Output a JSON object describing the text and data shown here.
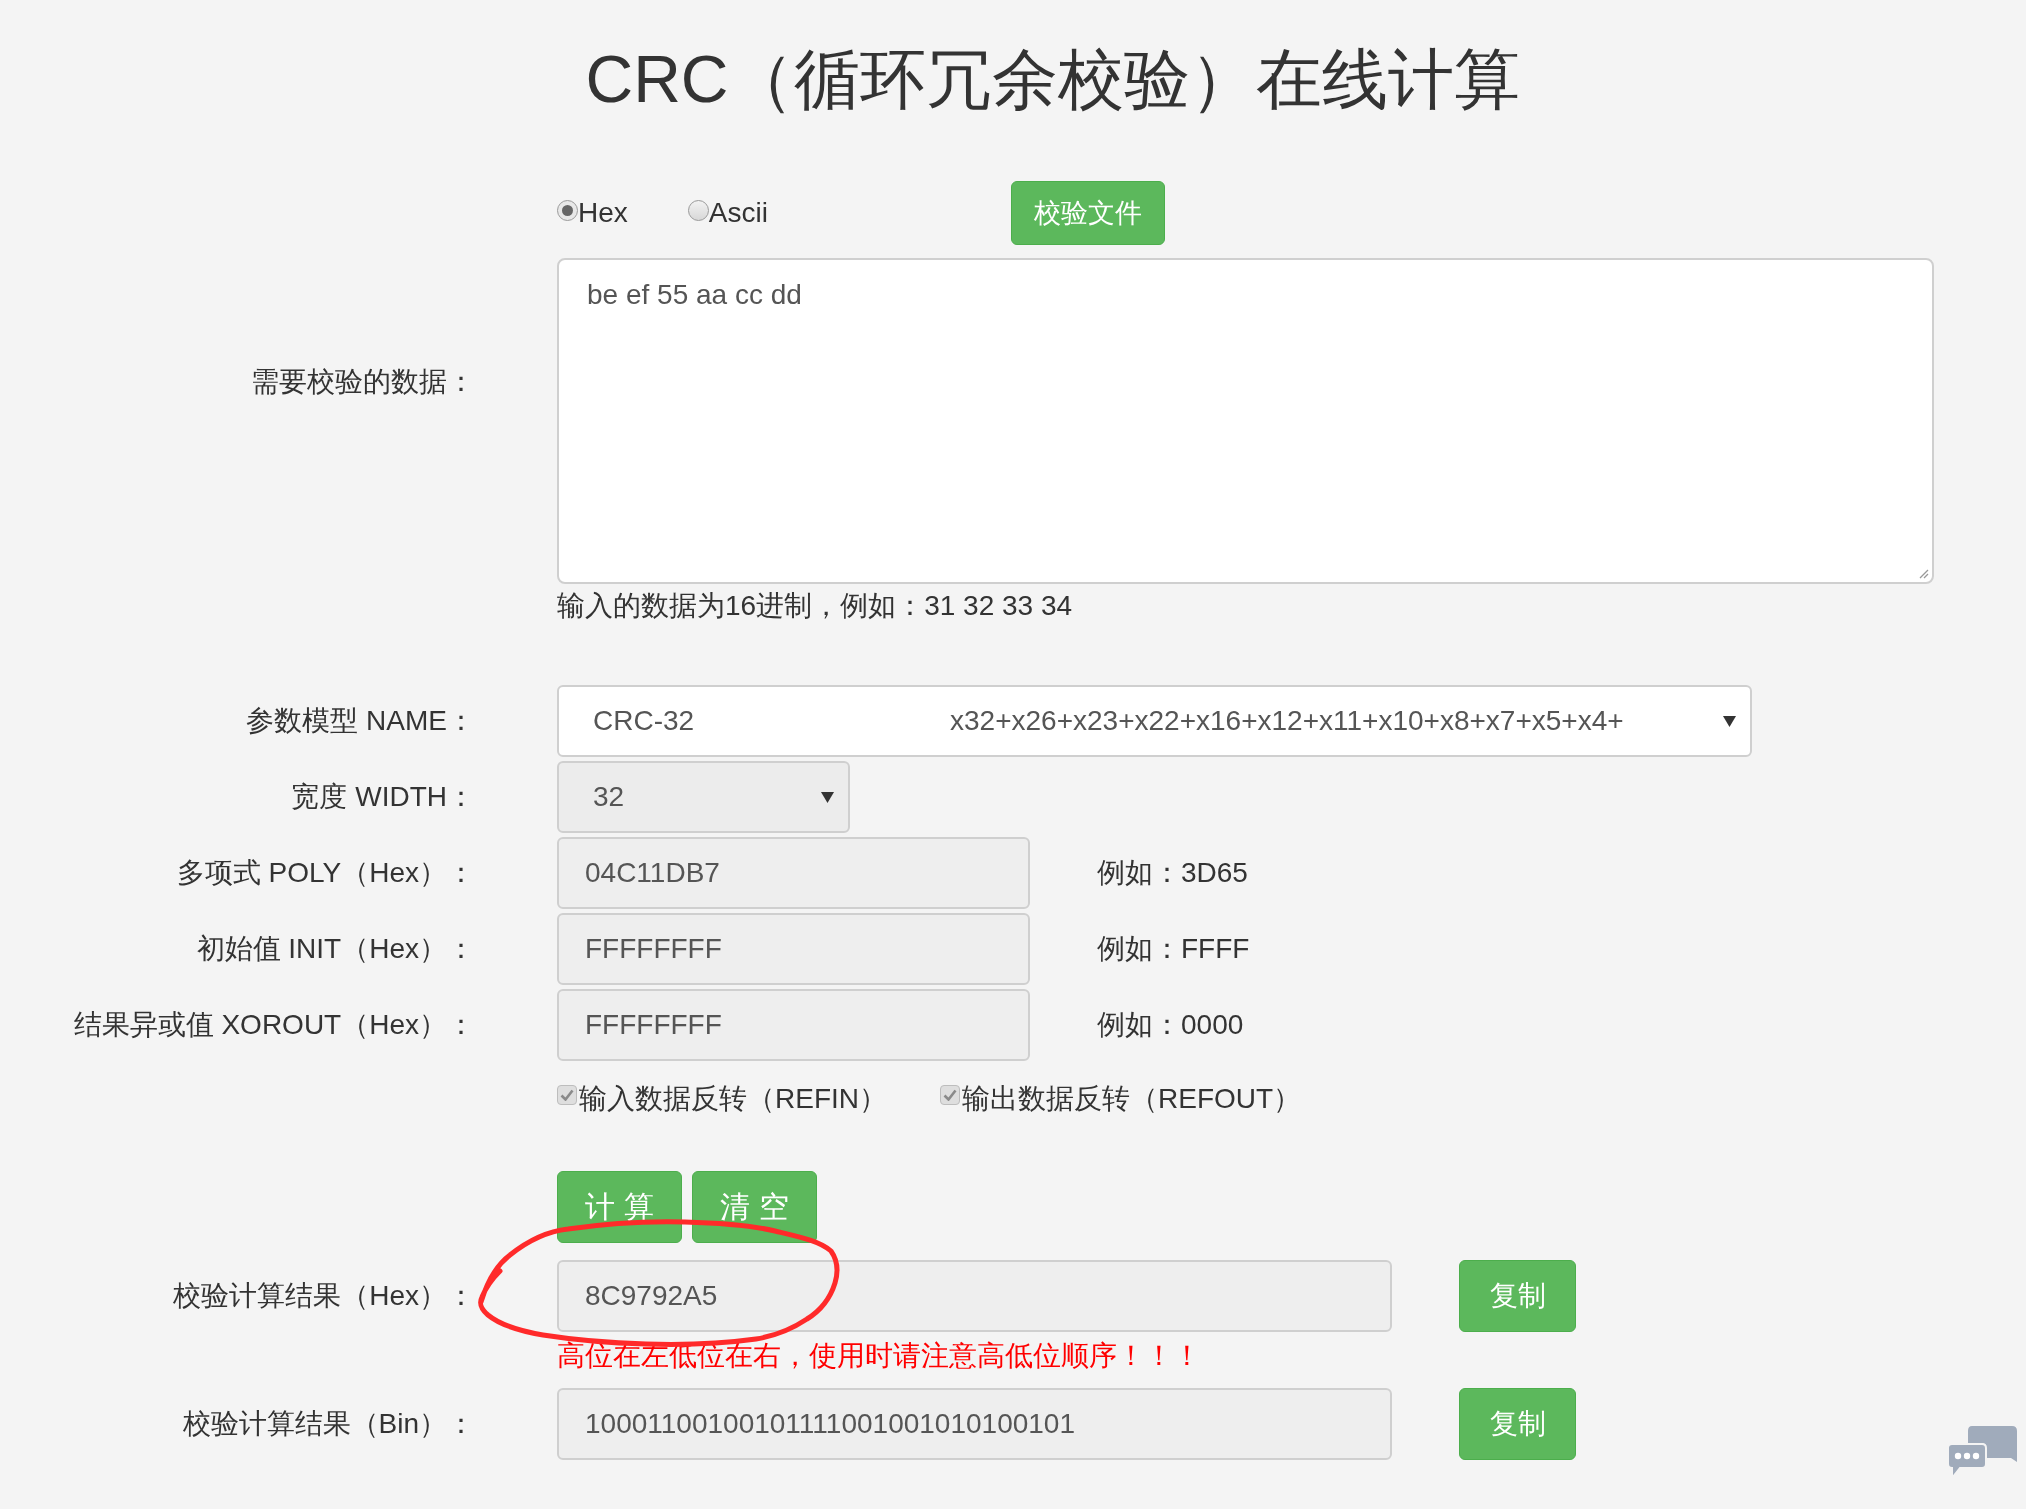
{
  "title": "CRC（循环冗余校验）在线计算",
  "input_mode": {
    "options": [
      {
        "label": "Hex",
        "selected": true
      },
      {
        "label": "Ascii",
        "selected": false
      }
    ],
    "file_button": "校验文件"
  },
  "data_field": {
    "label": "需要校验的数据：",
    "value": "be ef 55 aa cc dd",
    "hint": "输入的数据为16进制，例如：31 32 33 34"
  },
  "model": {
    "label": "参数模型 NAME：",
    "name": "CRC-32",
    "polynomial": "x32+x26+x23+x22+x16+x12+x11+x10+x8+x7+x5+x4+",
    "disabled": false
  },
  "width": {
    "label": "宽度 WIDTH：",
    "value": "32",
    "disabled": true
  },
  "params": [
    {
      "label": "多项式 POLY（Hex）：",
      "value": "04C11DB7",
      "example": "例如：3D65",
      "disabled": true
    },
    {
      "label": "初始值 INIT（Hex）：",
      "value": "FFFFFFFF",
      "example": "例如：FFFF",
      "disabled": true
    },
    {
      "label": "结果异或值 XOROUT（Hex）：",
      "value": "FFFFFFFF",
      "example": "例如：0000",
      "disabled": true
    }
  ],
  "options": [
    {
      "label": "输入数据反转（REFIN）",
      "checked": true,
      "disabled": true
    },
    {
      "label": "输出数据反转（REFOUT）",
      "checked": true,
      "disabled": true
    }
  ],
  "actions": [
    "计 算",
    "清 空"
  ],
  "results": [
    {
      "label": "校验计算结果（Hex）：",
      "value": "8C9792A5",
      "copy_button": "复制",
      "note": "高位在左低位在右，使用时请注意高低位顺序！！！",
      "disabled": true
    },
    {
      "label": "校验计算结果（Bin）：",
      "value": "10001100100101111001001010100101",
      "copy_button": "复制",
      "disabled": true
    }
  ]
}
